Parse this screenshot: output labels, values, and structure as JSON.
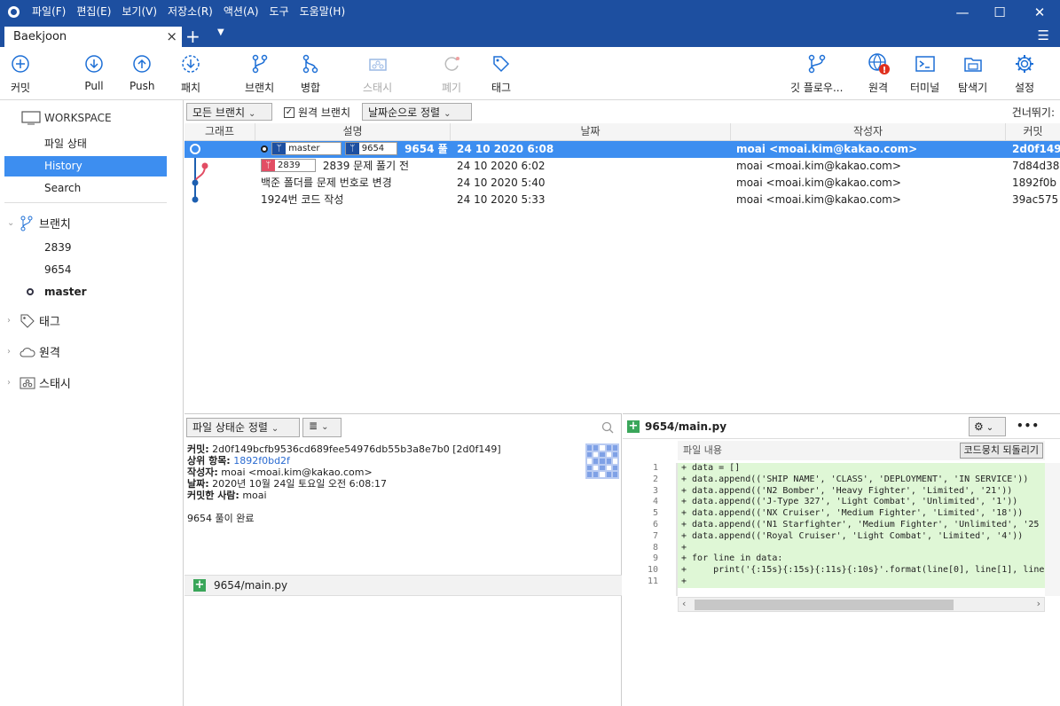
{
  "menu": {
    "items": [
      "파일(F)",
      "편집(E)",
      "보기(V)",
      "저장소(R)",
      "액션(A)",
      "도구",
      "도움말(H)"
    ]
  },
  "window": {
    "minimize": "—",
    "maximize": "☐",
    "close": "✕"
  },
  "tab": {
    "title": "Baekjoon",
    "close": "×",
    "new": "+",
    "menu": "▼",
    "hamburger": "☰"
  },
  "toolbar": {
    "commit": "커밋",
    "pull": "Pull",
    "push": "Push",
    "fetch": "패치",
    "branch": "브랜치",
    "merge": "병합",
    "stash": "스태시",
    "discard": "폐기",
    "tag": "태그",
    "gitflow": "깃 플로우...",
    "remote": "원격",
    "terminal": "터미널",
    "explorer": "탐색기",
    "settings": "설정"
  },
  "sidebar": {
    "workspace": "WORKSPACE",
    "items": [
      "파일 상태",
      "History",
      "Search"
    ],
    "branches_label": "브랜치",
    "branches": [
      "2839",
      "9654",
      "master"
    ],
    "tags_label": "태그",
    "remotes_label": "원격",
    "stashes_label": "스태시"
  },
  "filter": {
    "branches": "모든 브랜치",
    "remote_branches": "원격 브랜치",
    "sort": "날짜순으로 정렬",
    "jump": "건너뛰기:"
  },
  "columns": [
    "그래프",
    "설명",
    "날짜",
    "작성자",
    "커밋"
  ],
  "commits": [
    {
      "badges": [
        "master",
        "9654"
      ],
      "message": "9654 풀",
      "date": "24 10 2020 6:08",
      "author": "moai <moai.kim@kakao.com>",
      "hash": "2d0f149"
    },
    {
      "badges": [
        "2839"
      ],
      "message": "2839 문제 풀기 전",
      "date": "24 10 2020 6:02",
      "author": "moai <moai.kim@kakao.com>",
      "hash": "7d84d38"
    },
    {
      "badges": [],
      "message": "백준 폴더를 문제 번호로 변경",
      "date": "24 10 2020 5:40",
      "author": "moai <moai.kim@kakao.com>",
      "hash": "1892f0b"
    },
    {
      "badges": [],
      "message": "1924번 코드 작성",
      "date": "24 10 2020 5:33",
      "author": "moai <moai.kim@kakao.com>",
      "hash": "39ac575"
    }
  ],
  "file_panel": {
    "sort": "파일 상태순 정렬",
    "view": "≣",
    "commit_label": "커밋:",
    "commit_value": "2d0f149bcfb9536cd689fee54976db55b3a8e7b0 [2d0f149]",
    "parent_label": "상위 항목:",
    "parent_value": "1892f0bd2f",
    "author_label": "작성자:",
    "author_value": "moai <moai.kim@kakao.com>",
    "date_label": "날짜:",
    "date_value": "2020년 10월 24일 토요일 오전 6:08:17",
    "committer_label": "커밋한 사람:",
    "committer_value": "moai",
    "message": "9654 풀이 완료",
    "changed_file": "9654/main.py"
  },
  "diff": {
    "file": "9654/main.py",
    "hunk": "파일 내용",
    "revert": "코드뭉치 되돌리기",
    "more": "•••",
    "lines": [
      {
        "n": "1",
        "code": "+ data = []"
      },
      {
        "n": "2",
        "code": "+ data.append(('SHIP NAME', 'CLASS', 'DEPLOYMENT', 'IN SERVICE'))"
      },
      {
        "n": "3",
        "code": "+ data.append(('N2 Bomber', 'Heavy Fighter', 'Limited', '21'))"
      },
      {
        "n": "4",
        "code": "+ data.append(('J-Type 327', 'Light Combat', 'Unlimited', '1'))"
      },
      {
        "n": "5",
        "code": "+ data.append(('NX Cruiser', 'Medium Fighter', 'Limited', '18'))"
      },
      {
        "n": "6",
        "code": "+ data.append(('N1 Starfighter', 'Medium Fighter', 'Unlimited', '25"
      },
      {
        "n": "7",
        "code": "+ data.append(('Royal Cruiser', 'Light Combat', 'Limited', '4'))"
      },
      {
        "n": "8",
        "code": "+"
      },
      {
        "n": "9",
        "code": "+ for line in data:"
      },
      {
        "n": "10",
        "code": "+     print('{:15s}{:15s}{:11s}{:10s}'.format(line[0], line[1], line[2"
      },
      {
        "n": "11",
        "code": "+"
      }
    ]
  }
}
